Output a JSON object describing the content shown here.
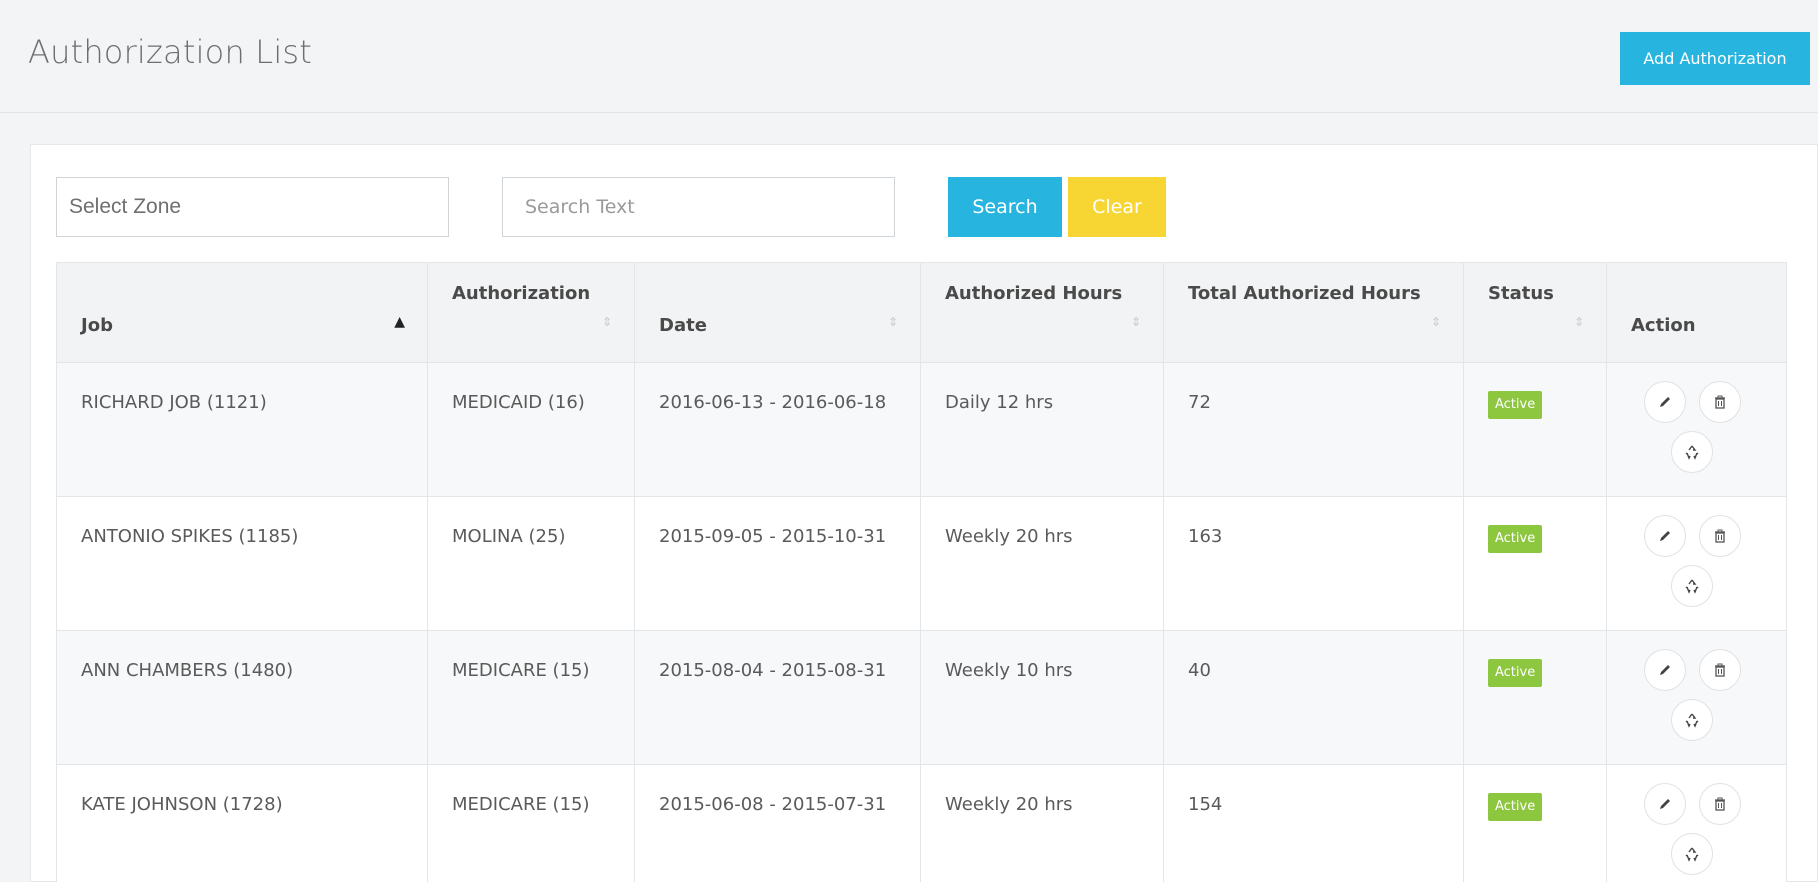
{
  "header": {
    "title": "Authorization List",
    "add_button": "Add Authorization"
  },
  "filters": {
    "zone_placeholder": "Select Zone",
    "search_placeholder": "Search Text",
    "search_button": "Search",
    "clear_button": "Clear"
  },
  "table": {
    "columns": [
      {
        "label": "Job",
        "sort": "asc"
      },
      {
        "label": "Authorization",
        "sort": "none"
      },
      {
        "label": "Date",
        "sort": "none"
      },
      {
        "label": "Authorized Hours",
        "sort": "none"
      },
      {
        "label": "Total Authorized Hours",
        "sort": "none"
      },
      {
        "label": "Status",
        "sort": "none"
      },
      {
        "label": "Action",
        "sort": null
      }
    ],
    "rows": [
      {
        "job": "RICHARD JOB (1121)",
        "authorization": "MEDICAID (16)",
        "date": "2016-06-13 - 2016-06-18",
        "authorized_hours": "Daily 12 hrs",
        "total_hours": "72",
        "status": "Active"
      },
      {
        "job": "ANTONIO SPIKES (1185)",
        "authorization": "MOLINA (25)",
        "date": "2015-09-05 - 2015-10-31",
        "authorized_hours": "Weekly 20 hrs",
        "total_hours": "163",
        "status": "Active"
      },
      {
        "job": "ANN CHAMBERS (1480)",
        "authorization": "MEDICARE (15)",
        "date": "2015-08-04 - 2015-08-31",
        "authorized_hours": "Weekly 10 hrs",
        "total_hours": "40",
        "status": "Active"
      },
      {
        "job": "KATE JOHNSON (1728)",
        "authorization": "MEDICARE (15)",
        "date": "2015-06-08 - 2015-07-31",
        "authorized_hours": "Weekly 20 hrs",
        "total_hours": "154",
        "status": "Active"
      }
    ]
  },
  "colors": {
    "primary": "#27b5e0",
    "warning": "#f7d633",
    "success": "#8dc63f"
  },
  "icons": {
    "edit": "pencil-icon",
    "delete": "trash-icon",
    "restore": "recycle-icon",
    "sort_asc": "sort-asc-icon",
    "sort_both": "sort-both-icon"
  }
}
